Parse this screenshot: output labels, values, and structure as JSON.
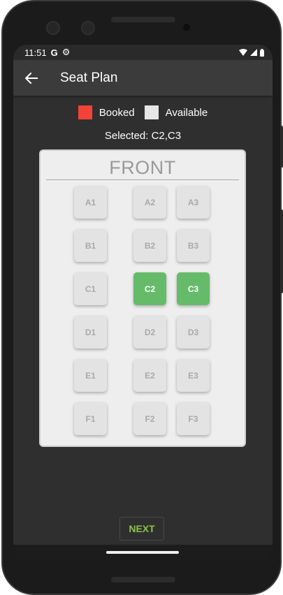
{
  "status": {
    "time": "11:51",
    "g_label": "G"
  },
  "app": {
    "title": "Seat Plan"
  },
  "legend": {
    "booked_label": "Booked",
    "available_label": "Available",
    "booked_color": "#f44336",
    "available_color": "#e6e6e6"
  },
  "selected_text": "Selected: C2,C3",
  "plan": {
    "front_label": "FRONT",
    "seats": [
      {
        "label": "A1",
        "selected": false
      },
      {
        "label": "A2",
        "selected": false
      },
      {
        "label": "A3",
        "selected": false
      },
      {
        "label": "B1",
        "selected": false
      },
      {
        "label": "B2",
        "selected": false
      },
      {
        "label": "B3",
        "selected": false
      },
      {
        "label": "C1",
        "selected": false
      },
      {
        "label": "C2",
        "selected": true
      },
      {
        "label": "C3",
        "selected": true
      },
      {
        "label": "D1",
        "selected": false
      },
      {
        "label": "D2",
        "selected": false
      },
      {
        "label": "D3",
        "selected": false
      },
      {
        "label": "E1",
        "selected": false
      },
      {
        "label": "E2",
        "selected": false
      },
      {
        "label": "E3",
        "selected": false
      },
      {
        "label": "F1",
        "selected": false
      },
      {
        "label": "F2",
        "selected": false
      },
      {
        "label": "F3",
        "selected": false
      }
    ],
    "selected_color": "#66bb6a"
  },
  "next_label": "NEXT",
  "icons": {
    "back": "arrow-back-icon",
    "settings": "gear-icon",
    "wifi": "wifi-icon",
    "signal": "signal-icon",
    "battery": "battery-icon"
  }
}
